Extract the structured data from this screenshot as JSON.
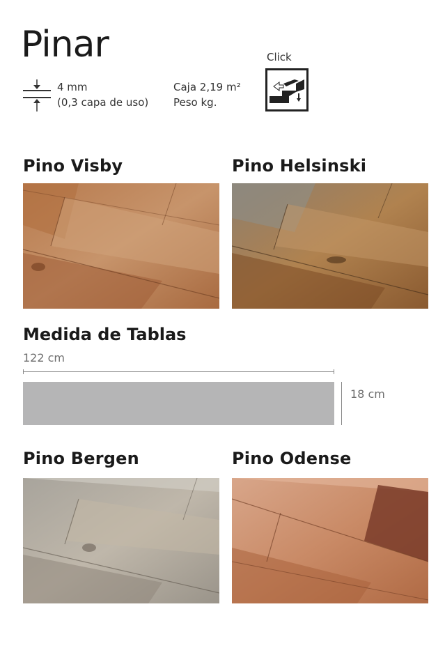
{
  "title": "Pinar",
  "specs": {
    "thickness": "4 mm",
    "wear_layer": "(0,3 capa de uso)",
    "box": "Caja 2,19 m²",
    "weight": "Peso kg."
  },
  "click": {
    "label": "Click"
  },
  "products": [
    {
      "name": "Pino Visby"
    },
    {
      "name": "Pino Helsinski"
    },
    {
      "name": "Pino Bergen"
    },
    {
      "name": "Pino Odense"
    }
  ],
  "plank": {
    "title": "Medida de Tablas",
    "length": "122 cm",
    "width": "18 cm"
  },
  "colors": {
    "plank_gray": "#b5b5b6",
    "text": "#1a1a1a",
    "muted": "#6e6e6e"
  }
}
